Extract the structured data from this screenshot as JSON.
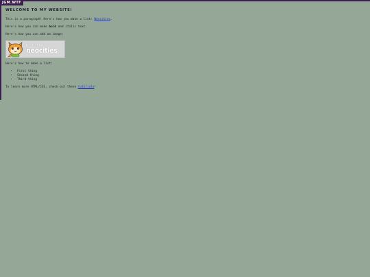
{
  "site_tag": "JGM.WTF",
  "heading": "Welcome to my Website!",
  "heading_mark": "~~",
  "para1": {
    "prefix": "This is a paragraph! Here's how you make a link: ",
    "link": "Neocities",
    "suffix": "."
  },
  "para2": {
    "prefix": "Here's how you can make ",
    "bold": "bold",
    "middle": " and ",
    "italic": "italic",
    "suffix": " text."
  },
  "para3": "Here's how you can add an image:",
  "badge": {
    "line1": "hosted by",
    "line2": "neocities"
  },
  "para4": "Here's how to make a list:",
  "list_items": [
    "First thing",
    "Second thing",
    "Third thing"
  ],
  "para5": {
    "prefix": "To learn more HTML/CSS, check out these ",
    "link": "tutorials",
    "suffix": "!"
  },
  "colors": {
    "background": "#95a898",
    "accent": "#3a1f4f",
    "link": "#1e35d0"
  }
}
